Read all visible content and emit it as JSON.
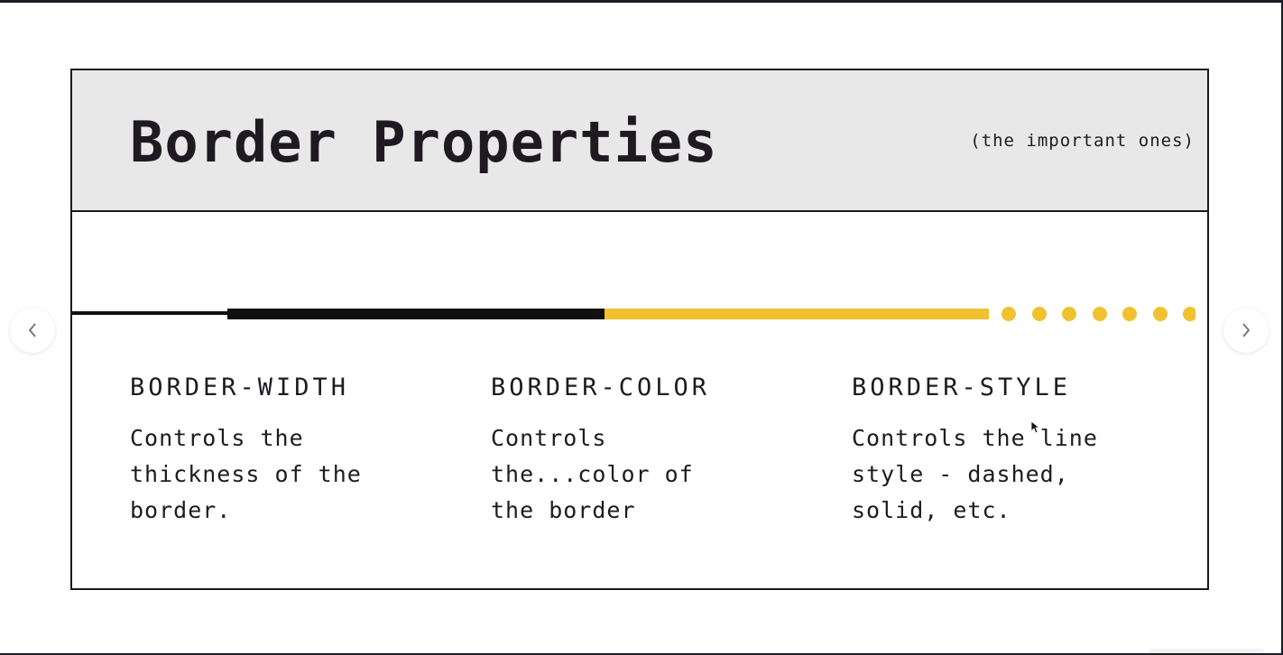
{
  "slide": {
    "title": "Border Properties",
    "subtitle": "(the important ones)",
    "columns": [
      {
        "heading": "BORDER-WIDTH",
        "text": "Controls the\nthickness of the\nborder."
      },
      {
        "heading": "BORDER-COLOR",
        "text": "Controls\nthe...color of\nthe border"
      },
      {
        "heading": "BORDER-STYLE",
        "text": "Controls the line\nstyle - dashed,\nsolid, etc."
      }
    ]
  },
  "demo_line": {
    "segments": [
      "thin-solid-black",
      "thick-solid-black",
      "thick-solid-yellow",
      "dotted-yellow"
    ],
    "colors": {
      "black": "#111111",
      "yellow": "#f0c230"
    }
  },
  "navigation": {
    "prev_icon": "chevron-left-icon",
    "next_icon": "chevron-right-icon"
  },
  "colors": {
    "header_background": "#e8e8e8",
    "text": "#1f1a22",
    "border": "#1a1a1a"
  }
}
